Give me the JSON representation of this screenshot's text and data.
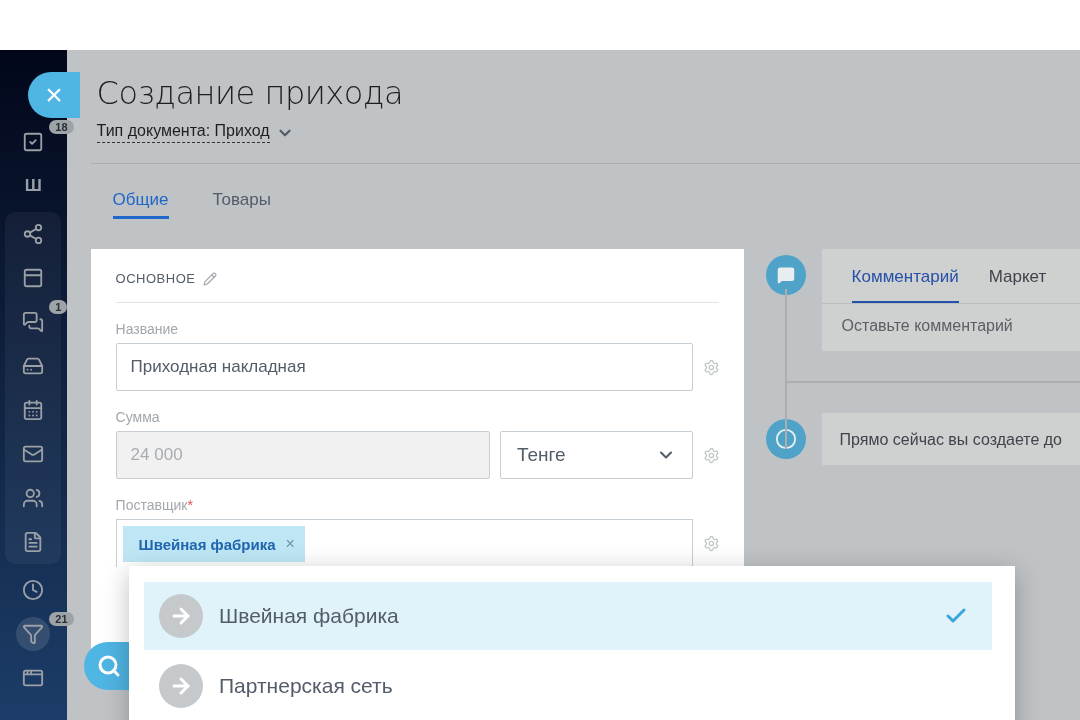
{
  "close_button": {
    "label": "×"
  },
  "sidebar": {
    "items": [
      {
        "badge": "18",
        "selected": false
      },
      {
        "glyph": "Ш",
        "selected": false
      }
    ],
    "group": [
      {
        "selected": false
      },
      {
        "selected": false
      },
      {
        "badge": "1",
        "selected": false
      },
      {
        "selected": false
      },
      {
        "selected": false
      },
      {
        "selected": false
      },
      {
        "selected": false
      },
      {
        "selected": false
      }
    ],
    "bottom": [
      {
        "selected": false
      },
      {
        "badge": "21",
        "selected": true
      },
      {
        "selected": false
      }
    ]
  },
  "header": {
    "title": "Создание прихода",
    "doc_type": "Тип документа: Приход"
  },
  "tabs": [
    {
      "label": "Общие",
      "selected": true
    },
    {
      "label": "Товары",
      "selected": false
    }
  ],
  "form": {
    "section": "ОСНОВНОЕ",
    "fields": [
      {
        "kind": "text",
        "label": "Название",
        "value": "Приходная накладная"
      },
      {
        "kind": "money",
        "label": "Сумма",
        "value": "24 000",
        "disabled": true,
        "currency": "Тенге"
      },
      {
        "kind": "tags",
        "label": "Поставщик",
        "required_mark": "*",
        "tags": [
          {
            "label": "Швейная фабрика",
            "remove": "×"
          }
        ]
      }
    ]
  },
  "timeline": {
    "comment": {
      "tabs": [
        {
          "label": "Комментарий",
          "selected": true
        },
        {
          "label": "Маркет",
          "selected": false
        }
      ],
      "placeholder": "Оставьте комментарий"
    },
    "info": "Прямо сейчас вы создаете до"
  },
  "dropdown": {
    "items": [
      {
        "label": "Швейная фабрика",
        "selected": true
      },
      {
        "label": "Партнерская сеть",
        "selected": false
      }
    ]
  }
}
